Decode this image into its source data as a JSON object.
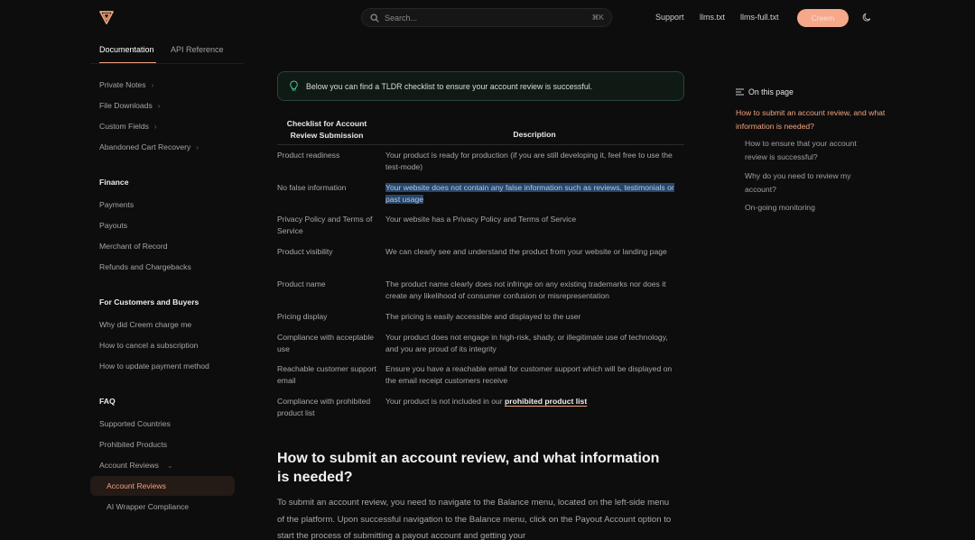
{
  "header": {
    "search_placeholder": "Search...",
    "search_shortcut": "⌘K",
    "links": [
      "Support",
      "llms.txt",
      "llms-full.txt"
    ],
    "cta_label": "Creem",
    "accent_color": "#f3a37f"
  },
  "sidebar": {
    "tabs": [
      "Documentation",
      "API Reference"
    ],
    "active_tab": "Documentation",
    "items_top": [
      {
        "label": "Private Notes",
        "chevron": true
      },
      {
        "label": "File Downloads",
        "chevron": true
      },
      {
        "label": "Custom Fields",
        "chevron": true
      },
      {
        "label": "Abandoned Cart Recovery",
        "chevron": true
      }
    ],
    "sections": [
      {
        "heading": "Finance",
        "items": [
          "Payments",
          "Payouts",
          "Merchant of Record",
          "Refunds and Chargebacks"
        ]
      },
      {
        "heading": "For Customers and Buyers",
        "items": [
          "Why did Creem charge me",
          "How to cancel a subscription",
          "How to update payment method"
        ]
      },
      {
        "heading": "FAQ",
        "items": [
          "Supported Countries",
          "Prohibited Products",
          "Account Reviews"
        ]
      }
    ],
    "sub_items": [
      "Account Reviews",
      "AI Wrapper Compliance"
    ],
    "active_item": "Account Reviews"
  },
  "main": {
    "callout": "Below you can find a TLDR checklist to ensure your account review is successful.",
    "table": {
      "headers": [
        "Checklist for Account Review Submission",
        "Description"
      ],
      "rows": [
        {
          "check": "Product readiness",
          "desc": "Your product is ready for production (if you are still developing it, feel free to use the test-mode)"
        },
        {
          "check": "No false information",
          "desc": "Your website does not contain any false information such as reviews, testimonials or past usage"
        },
        {
          "check": "Privacy Policy and Terms of Service",
          "desc": "Your website has a Privacy Policy and Terms of Service"
        },
        {
          "check": "Product visibility",
          "desc": "We can clearly see and understand the product from your website or landing page"
        },
        {
          "check": "Product name",
          "desc": "The product name clearly does not infringe on any existing trademarks nor does it create any likelihood of consumer confusion or misrepresentation"
        },
        {
          "check": "Pricing display",
          "desc": "The pricing is easily accessible and displayed to the user"
        },
        {
          "check": "Compliance with acceptable use",
          "desc": "Your product does not engage in high-risk, shady, or illegitimate use of technology, and you are proud of its integrity"
        },
        {
          "check": "Reachable customer support email",
          "desc": "Ensure you have a reachable email for customer support which will be displayed on the email receipt customers receive"
        },
        {
          "check": "Compliance with prohibited product list",
          "desc_prefix": "Your product is not included in our ",
          "desc_link": "prohibited product list"
        }
      ]
    },
    "heading": "How to submit an account review, and what information is needed?",
    "paragraph": "To submit an account review, you need to navigate to the Balance menu, located on the left-side menu of the platform. Upon successful navigation to the Balance menu, click on the Payout Account option to start the process of submitting a payout account and getting your"
  },
  "toc": {
    "title": "On this page",
    "items": [
      {
        "label": "How to submit an account review, and what information is needed?",
        "active": true
      },
      {
        "label": "How to ensure that your account review is successful?",
        "active": false
      },
      {
        "label": "Why do you need to review my account?",
        "active": false
      },
      {
        "label": "On-going monitoring",
        "active": false
      }
    ]
  }
}
